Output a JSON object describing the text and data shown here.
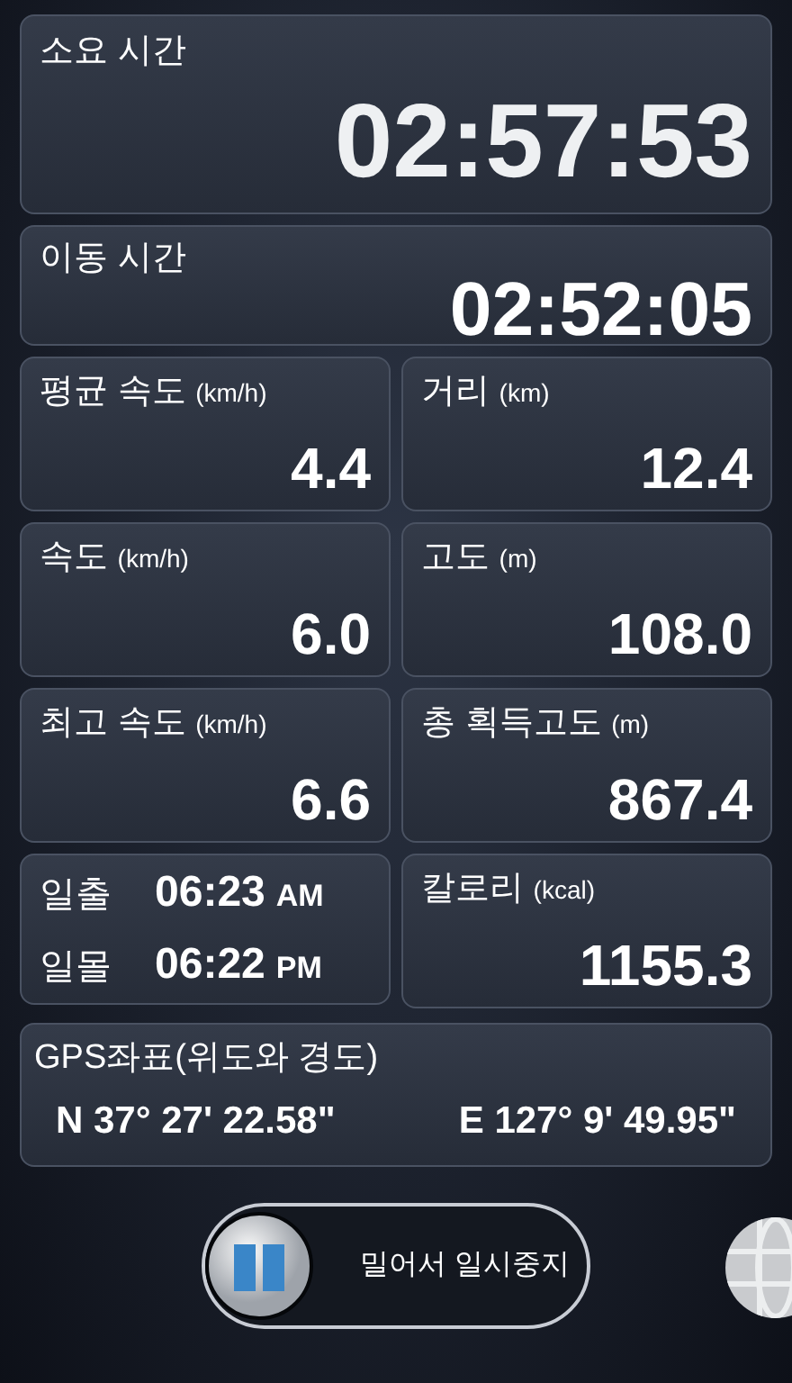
{
  "elapsed": {
    "label": "소요 시간",
    "value": "02:57:53"
  },
  "moving": {
    "label": "이동 시간",
    "value": "02:52:05"
  },
  "stats": [
    {
      "label": "평균 속도",
      "unit": "(km/h)",
      "value": "4.4"
    },
    {
      "label": "거리",
      "unit": "(km)",
      "value": "12.4"
    },
    {
      "label": "속도",
      "unit": "(km/h)",
      "value": "6.0"
    },
    {
      "label": "고도",
      "unit": "(m)",
      "value": "108.0"
    },
    {
      "label": "최고 속도",
      "unit": "(km/h)",
      "value": "6.6"
    },
    {
      "label": "총 획득고도",
      "unit": "(m)",
      "value": "867.4"
    }
  ],
  "sun": [
    {
      "label": "일출",
      "time": "06:23",
      "ampm": "AM"
    },
    {
      "label": "일몰",
      "time": "06:22",
      "ampm": "PM"
    }
  ],
  "calories": {
    "label": "칼로리",
    "unit": "(kcal)",
    "value": "1155.3"
  },
  "gps": {
    "label": "GPS좌표(위도와 경도)",
    "latitude": "N 37° 27' 22.58\"",
    "longitude": "E 127° 9' 49.95\""
  },
  "slider": {
    "label": "밀어서 일시중지",
    "level": 0
  }
}
